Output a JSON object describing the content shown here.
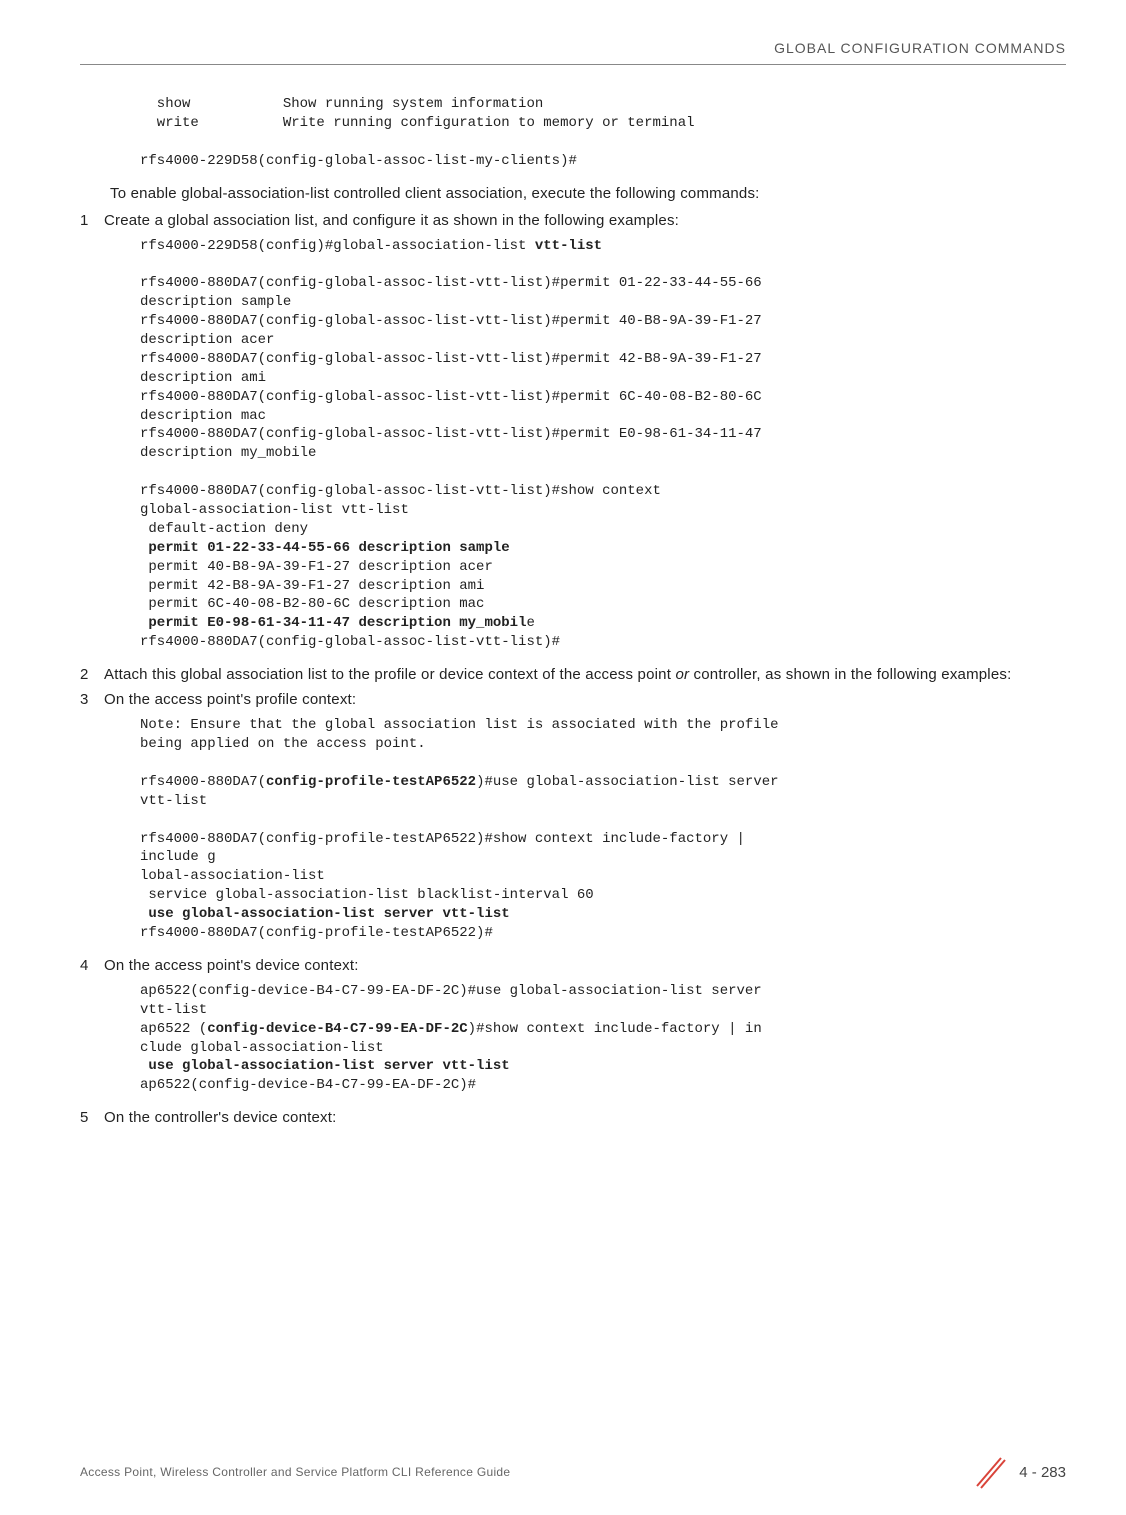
{
  "header": "GLOBAL CONFIGURATION COMMANDS",
  "code1": "  show           Show running system information\n  write          Write running configuration to memory or terminal\n\nrfs4000-229D58(config-global-assoc-list-my-clients)#",
  "prose1": "To enable global-association-list controlled client association, execute the following commands:",
  "step1num": "1",
  "step1text": "Create a global association list, and configure it as shown in the following examples:",
  "code2a": "rfs4000-229D58(config)#global-association-list ",
  "code2a_bold": "vtt-list",
  "code2b": "\n\nrfs4000-880DA7(config-global-assoc-list-vtt-list)#permit 01-22-33-44-55-66 \ndescription sample\nrfs4000-880DA7(config-global-assoc-list-vtt-list)#permit 40-B8-9A-39-F1-27 \ndescription acer\nrfs4000-880DA7(config-global-assoc-list-vtt-list)#permit 42-B8-9A-39-F1-27 \ndescription ami\nrfs4000-880DA7(config-global-assoc-list-vtt-list)#permit 6C-40-08-B2-80-6C \ndescription mac\nrfs4000-880DA7(config-global-assoc-list-vtt-list)#permit E0-98-61-34-11-47 \ndescription my_mobile\n\nrfs4000-880DA7(config-global-assoc-list-vtt-list)#show context\nglobal-association-list vtt-list\n default-action deny\n ",
  "code2b_bold1": "permit 01-22-33-44-55-66 description sample",
  "code2c": "\n permit 40-B8-9A-39-F1-27 description acer\n permit 42-B8-9A-39-F1-27 description ami\n permit 6C-40-08-B2-80-6C description mac\n ",
  "code2c_bold": "permit E0-98-61-34-11-47 description my_mobil",
  "code2d": "e\nrfs4000-880DA7(config-global-assoc-list-vtt-list)#",
  "step2num": "2",
  "step2text_a": "Attach this global association list to the profile or device context of the access point ",
  "step2text_b": "or",
  "step2text_c": " controller, as shown in the following examples:",
  "step3num": "3",
  "step3text": "On the access point's profile context:",
  "code3a": "Note: Ensure that the global association list is associated with the profile \nbeing applied on the access point.\n\nrfs4000-880DA7(",
  "code3a_bold": "config-profile-testAP6522",
  "code3b": ")#use global-association-list server \nvtt-list\n\nrfs4000-880DA7(config-profile-testAP6522)#show context include-factory | \ninclude g\nlobal-association-list\n service global-association-list blacklist-interval 60\n ",
  "code3b_bold": "use global-association-list server vtt-list",
  "code3c": "\nrfs4000-880DA7(config-profile-testAP6522)#",
  "step4num": "4",
  "step4text": "On the access point's device context:",
  "code4a": "ap6522(config-device-B4-C7-99-EA-DF-2C)#use global-association-list server \nvtt-list\nap6522 (",
  "code4a_bold": "config-device-B4-C7-99-EA-DF-2C",
  "code4b": ")#show context include-factory | in\nclude global-association-list\n ",
  "code4b_bold": "use global-association-list server vtt-list",
  "code4c": "\nap6522(config-device-B4-C7-99-EA-DF-2C)#",
  "step5num": "5",
  "step5text": "On the controller's device context:",
  "footer_left": "Access Point, Wireless Controller and Service Platform CLI Reference Guide",
  "footer_right": "4 - 283"
}
